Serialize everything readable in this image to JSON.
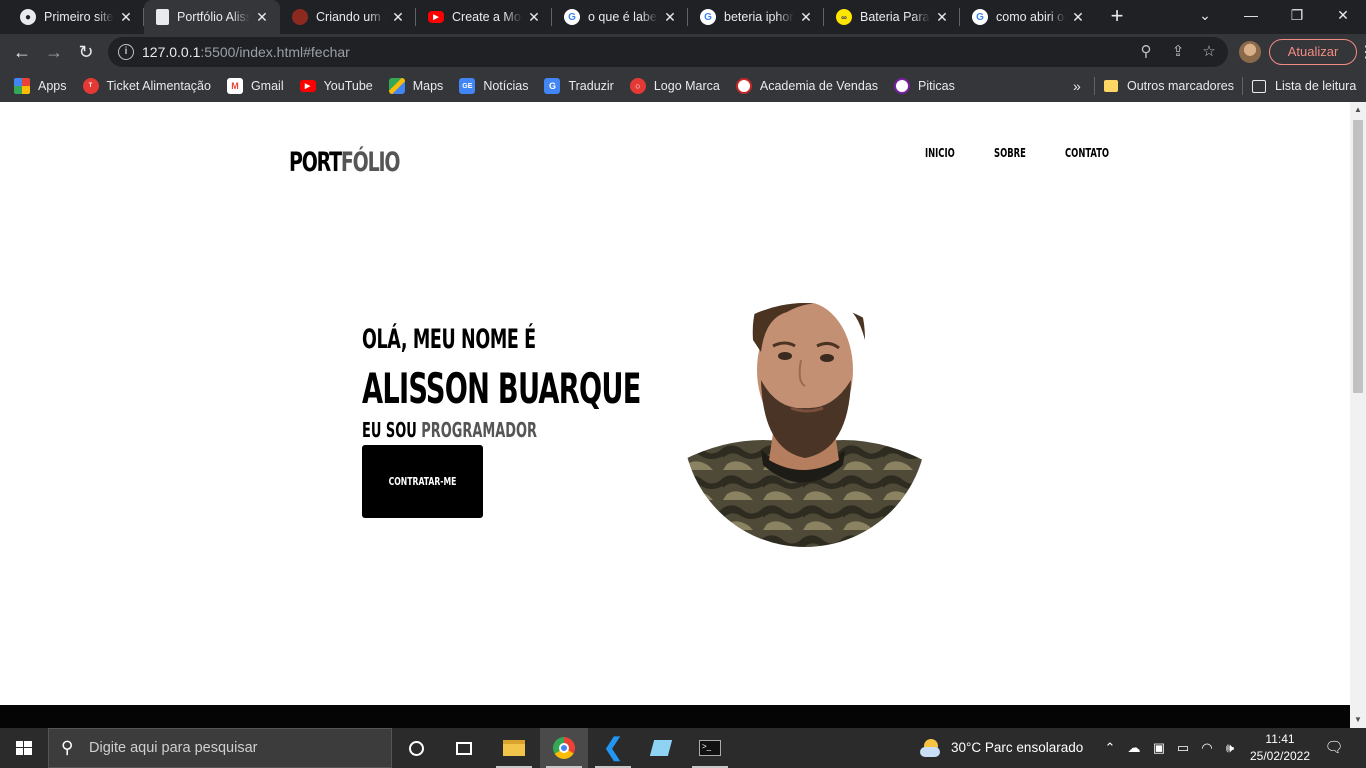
{
  "browser": {
    "tabs": [
      {
        "title": "Primeiro site",
        "icon": "github-icon"
      },
      {
        "title": "Portfólio Alisson",
        "icon": "page-icon"
      },
      {
        "title": "Criando um modal",
        "icon": "avatar-icon"
      },
      {
        "title": "Create a Modal",
        "icon": "youtube-icon"
      },
      {
        "title": "o que é label",
        "icon": "google-icon"
      },
      {
        "title": "beteria iphone",
        "icon": "google-icon"
      },
      {
        "title": "Bateria Para iPhone",
        "icon": "shop-icon"
      },
      {
        "title": "como abiri ou",
        "icon": "google-icon"
      }
    ],
    "url_host": "127.0.0.1",
    "url_path": ":5500/index.html#fechar",
    "update_label": "Atualizar",
    "bookmarks": [
      {
        "label": "Apps",
        "icon": "apps-grid-icon",
        "color": "#4285f4"
      },
      {
        "label": "Ticket Alimentação",
        "icon": "ticket-icon",
        "color": "#e53935"
      },
      {
        "label": "Gmail",
        "icon": "gmail-icon",
        "color": "#ea4335"
      },
      {
        "label": "YouTube",
        "icon": "youtube-icon",
        "color": "#ff0000"
      },
      {
        "label": "Maps",
        "icon": "maps-icon",
        "color": "#34a853"
      },
      {
        "label": "Notícias",
        "icon": "news-icon",
        "color": "#4285f4"
      },
      {
        "label": "Traduzir",
        "icon": "translate-icon",
        "color": "#4285f4"
      },
      {
        "label": "Logo Marca",
        "icon": "logo-marca-icon",
        "color": "#e53935"
      },
      {
        "label": "Academia de Vendas",
        "icon": "academia-icon",
        "color": "#c62828"
      },
      {
        "label": "Piticas",
        "icon": "piticas-icon",
        "color": "#7b1fa2"
      }
    ],
    "other_bookmarks": "Outros marcadores",
    "reading_list": "Lista de leitura"
  },
  "site": {
    "logo_part1": "PORT",
    "logo_part2": "FÓLIO",
    "menu": [
      "INICIO",
      "SOBRE",
      "CONTATO"
    ],
    "hero": {
      "greeting": "OLÁ, MEU NOME É",
      "name": "ALISSON BUARQUE",
      "role_prefix": "EU SOU",
      "role_highlight": "PROGRAMADOR",
      "cta": "CONTRATAR-ME"
    }
  },
  "taskbar": {
    "search_placeholder": "Digite aqui para pesquisar",
    "weather": "30°C  Parc ensolarado",
    "time": "11:41",
    "date": "25/02/2022"
  }
}
